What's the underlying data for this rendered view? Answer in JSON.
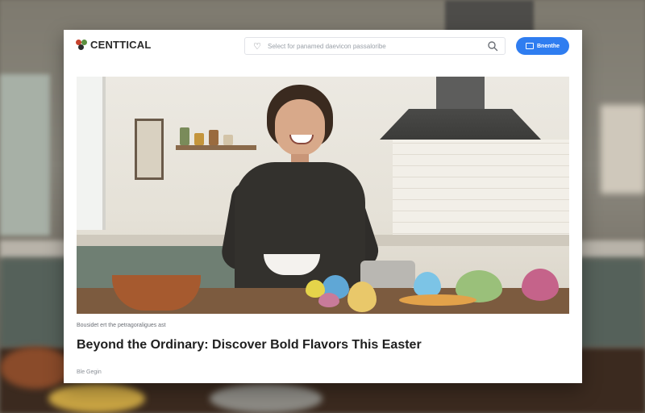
{
  "brand": {
    "name": "CENTTICAL",
    "logo_icon": "three-dots-logo-icon",
    "logo_colors": [
      "#c6422d",
      "#5b8f3e",
      "#2c2c2c"
    ]
  },
  "search": {
    "placeholder": "Select for panamed daevicon passaloribe",
    "leading_icon": "heart-icon",
    "trailing_icon": "search-icon"
  },
  "cta_button": {
    "label": "Bnenthe",
    "icon": "card-icon",
    "color": "#2f7df0"
  },
  "article": {
    "kicker": "Bousidet ert the petragoraligues ast",
    "headline": "Beyond the Ordinary: Discover Bold Flavors This Easter",
    "byline": "Ble Gegin",
    "hero_image_alt_hint": "person-smiling-cooking-with-easter-eggs"
  }
}
